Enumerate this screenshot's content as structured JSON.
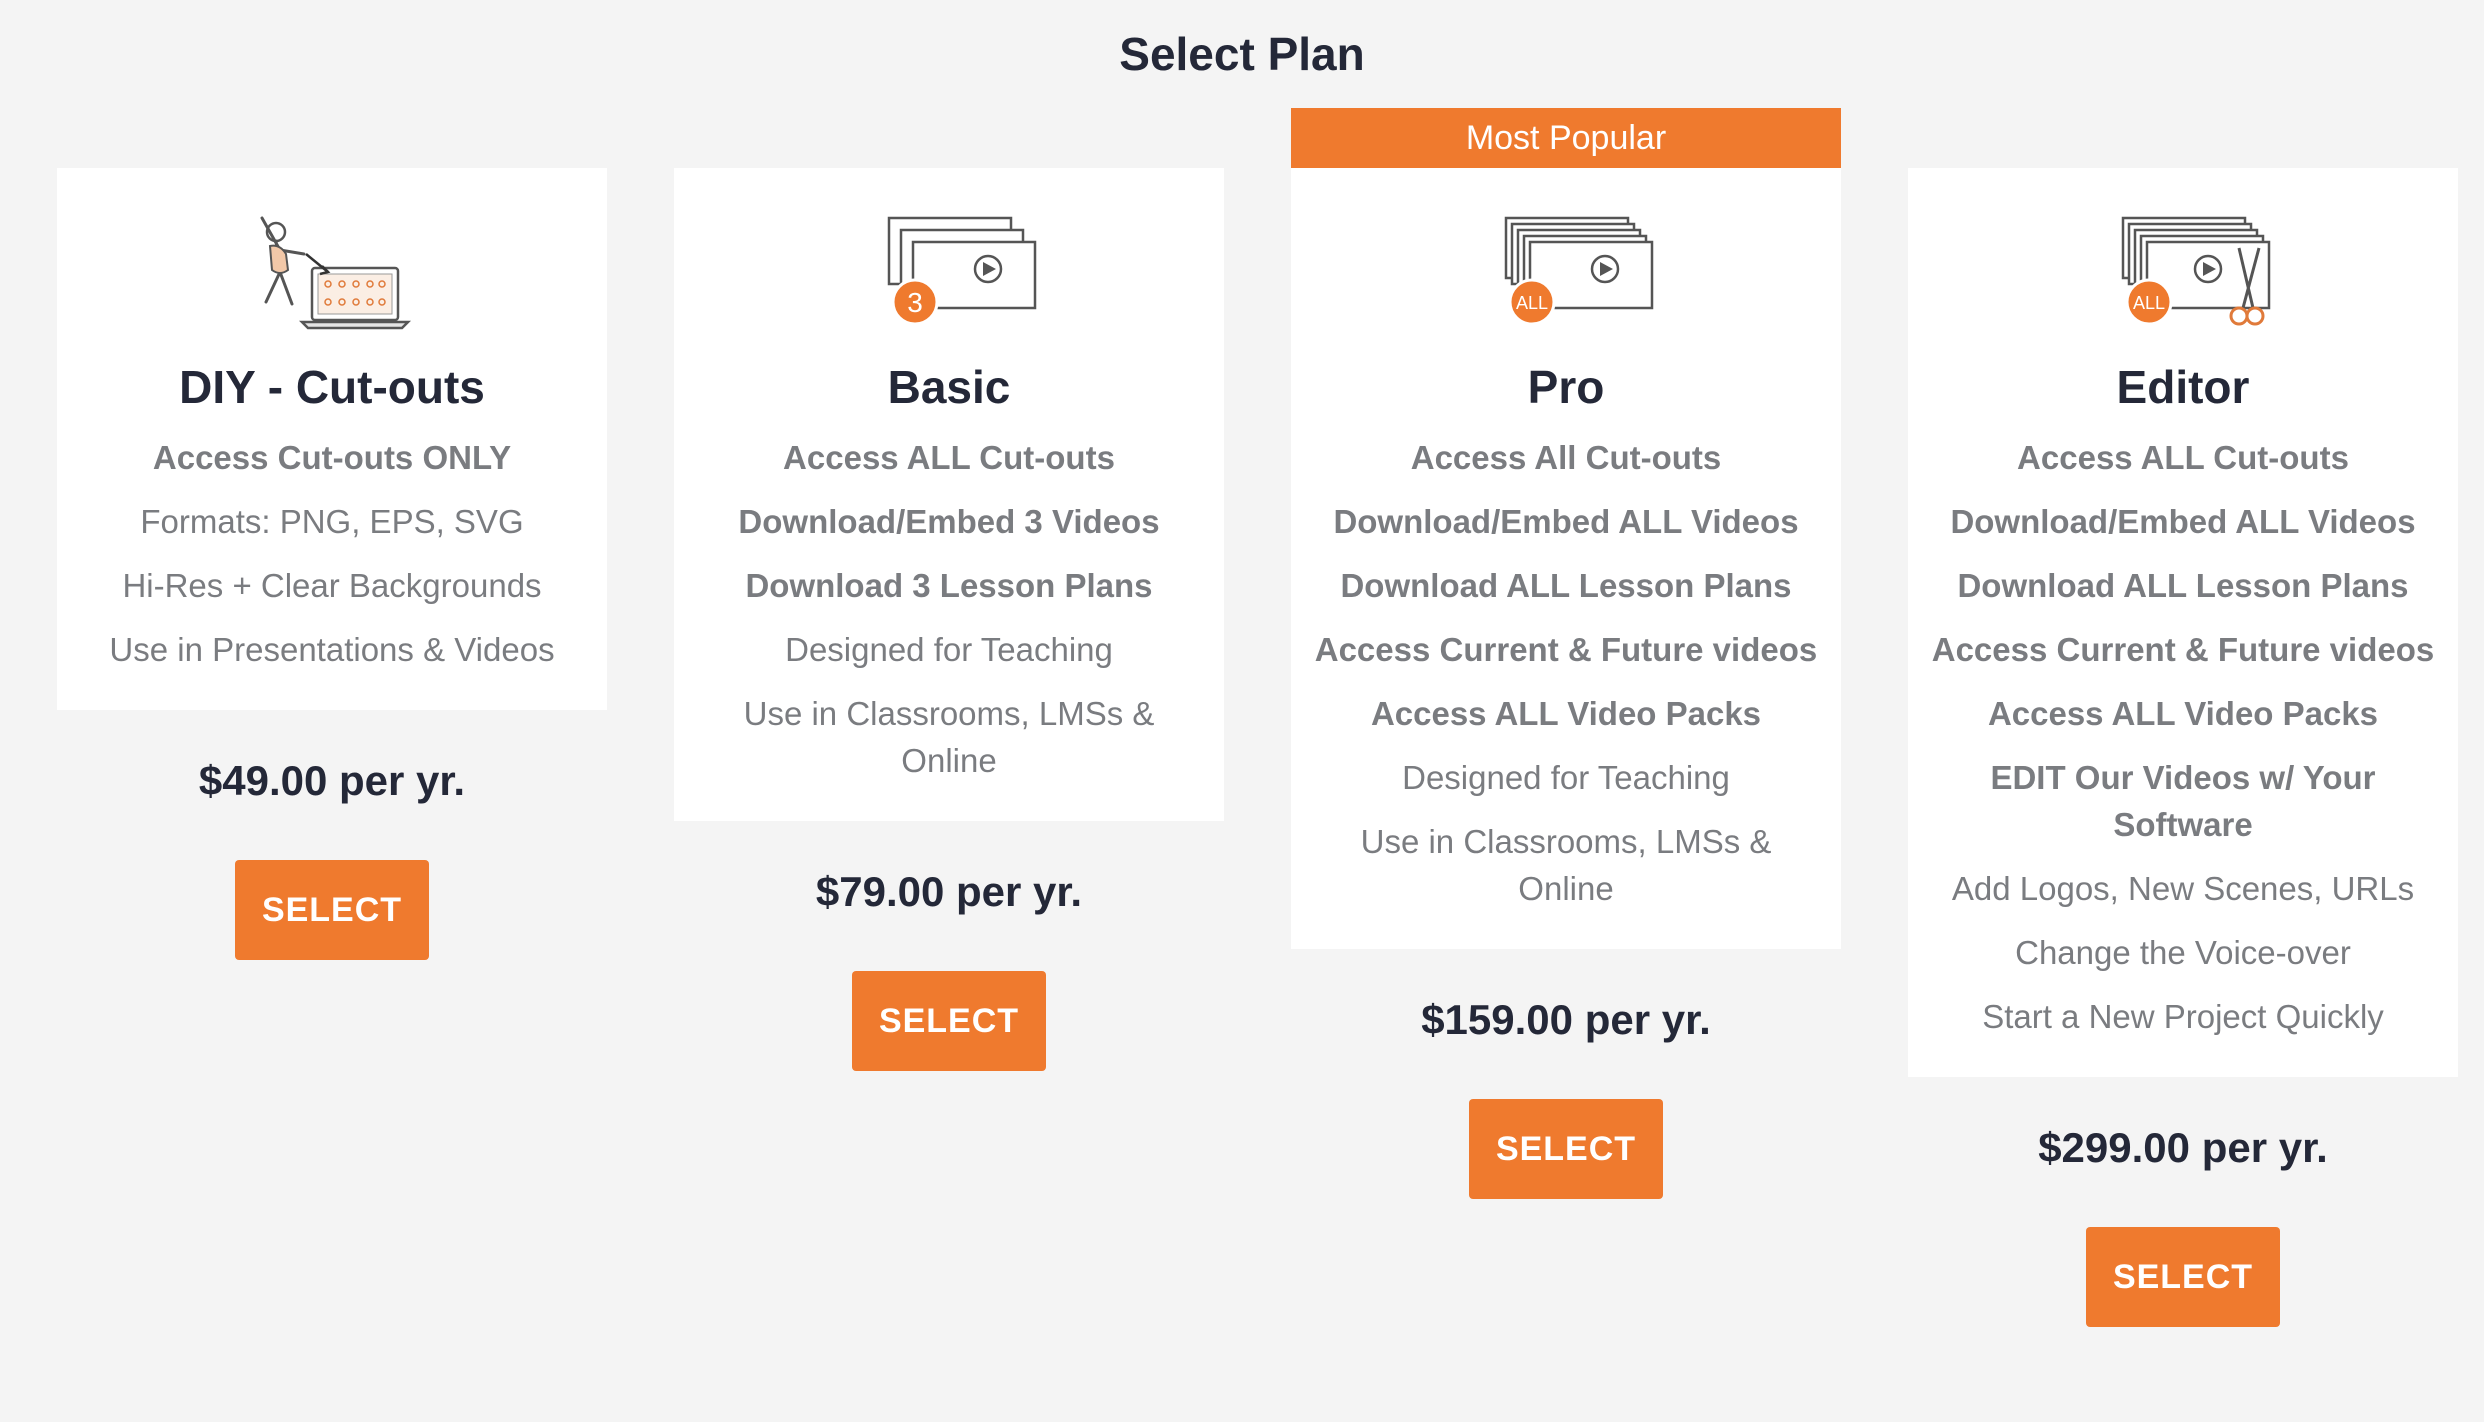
{
  "page": {
    "title": "Select Plan"
  },
  "colors": {
    "accent": "#ef7a2e",
    "heading": "#242838",
    "feature": "#7a7c80",
    "card": "#ffffff",
    "background": "#f4f4f4"
  },
  "plans": [
    {
      "name": "DIY - Cut-outs",
      "icon": "cutout-person-laptop-icon",
      "features": [
        {
          "text": "Access Cut-outs ONLY",
          "bold": true
        },
        {
          "text": "Formats: PNG, EPS, SVG",
          "bold": false
        },
        {
          "text": "Hi-Res + Clear Backgrounds",
          "bold": false
        },
        {
          "text": "Use in Presentations & Videos",
          "bold": false
        }
      ],
      "price": "$49.00 per yr.",
      "button": "SELECT"
    },
    {
      "name": "Basic",
      "icon": "three-videos-icon",
      "badge": "3",
      "features": [
        {
          "text": "Access ALL Cut-outs",
          "bold": true
        },
        {
          "text": "Download/Embed 3 Videos",
          "bold": true
        },
        {
          "text": "Download 3 Lesson Plans",
          "bold": true
        },
        {
          "text": "Designed for Teaching",
          "bold": false
        },
        {
          "text": "Use in Classrooms, LMSs & Online",
          "bold": false
        }
      ],
      "price": "$79.00 per yr.",
      "button": "SELECT"
    },
    {
      "name": "Pro",
      "banner": "Most Popular",
      "icon": "all-videos-icon",
      "badge": "ALL",
      "features": [
        {
          "text": "Access All Cut-outs",
          "bold": true
        },
        {
          "text": "Download/Embed ALL Videos",
          "bold": true
        },
        {
          "text": "Download ALL Lesson Plans",
          "bold": true
        },
        {
          "text": "Access Current & Future videos",
          "bold": true
        },
        {
          "text": "Access ALL Video Packs",
          "bold": true
        },
        {
          "text": "Designed for Teaching",
          "bold": false
        },
        {
          "text": "Use in Classrooms, LMSs & Online",
          "bold": false
        }
      ],
      "price": "$159.00 per yr.",
      "button": "SELECT"
    },
    {
      "name": "Editor",
      "icon": "all-videos-scissors-icon",
      "badge": "ALL",
      "features": [
        {
          "text": "Access ALL Cut-outs",
          "bold": true
        },
        {
          "text": "Download/Embed ALL Videos",
          "bold": true
        },
        {
          "text": "Download ALL Lesson Plans",
          "bold": true
        },
        {
          "text": "Access Current & Future videos",
          "bold": true
        },
        {
          "text": "Access ALL Video Packs",
          "bold": true
        },
        {
          "text": "EDIT Our Videos w/ Your Software",
          "bold": true
        },
        {
          "text": "Add Logos, New Scenes, URLs",
          "bold": false
        },
        {
          "text": "Change the Voice-over",
          "bold": false
        },
        {
          "text": "Start a New Project Quickly",
          "bold": false
        }
      ],
      "price": "$299.00 per yr.",
      "button": "SELECT"
    }
  ]
}
